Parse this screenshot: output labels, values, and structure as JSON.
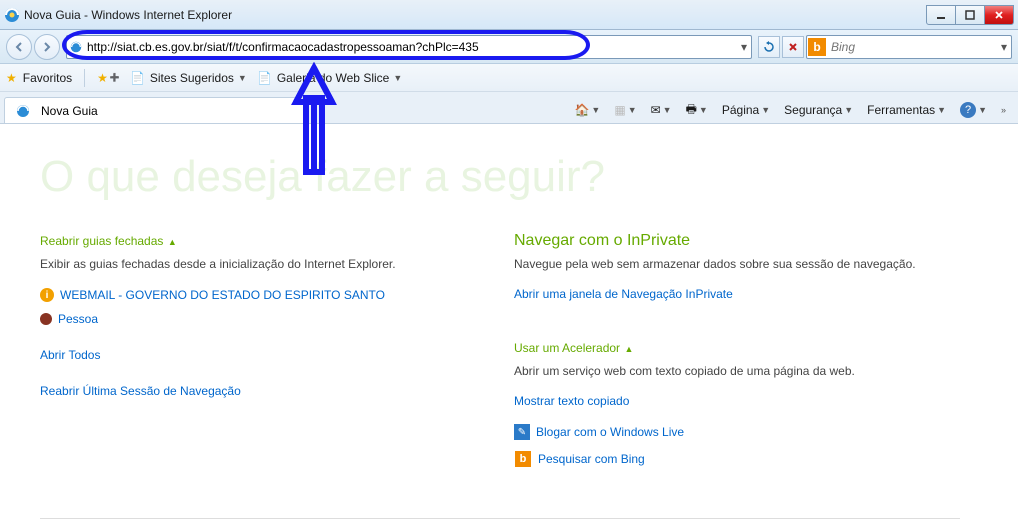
{
  "titlebar": {
    "title": "Nova Guia - Windows Internet Explorer"
  },
  "navbar": {
    "url": "http://siat.cb.es.gov.br/siat/f/t/confirmacaocadastropessoaman?chPlc=435",
    "search_placeholder": "Bing"
  },
  "favbar": {
    "favoritos": "Favoritos",
    "sites": "Sites Sugeridos",
    "galeria": "Galeria do Web Slice"
  },
  "tab": {
    "label": "Nova Guia"
  },
  "cmd": {
    "pagina": "Página",
    "seguranca": "Segurança",
    "ferramentas": "Ferramentas"
  },
  "content": {
    "big": "O que deseja fazer a seguir?",
    "reabrir": {
      "h": "Reabrir guias fechadas",
      "desc": "Exibir as guias fechadas desde a inicialização do Internet Explorer.",
      "link1": "WEBMAIL - GOVERNO DO ESTADO DO ESPIRITO SANTO",
      "link2": "Pessoa",
      "abrir": "Abrir Todos",
      "sessao": "Reabrir Última Sessão de Navegação"
    },
    "inprivate": {
      "h": "Navegar com o InPrivate",
      "desc": "Navegue pela web sem armazenar dados sobre sua sessão de navegação.",
      "link": "Abrir uma janela de Navegação InPrivate"
    },
    "acel": {
      "h": "Usar um Acelerador",
      "desc": "Abrir um serviço web com texto copiado de uma página da web.",
      "mostrar": "Mostrar texto copiado",
      "blogar": "Blogar com o Windows Live",
      "pesq": "Pesquisar com Bing"
    }
  }
}
